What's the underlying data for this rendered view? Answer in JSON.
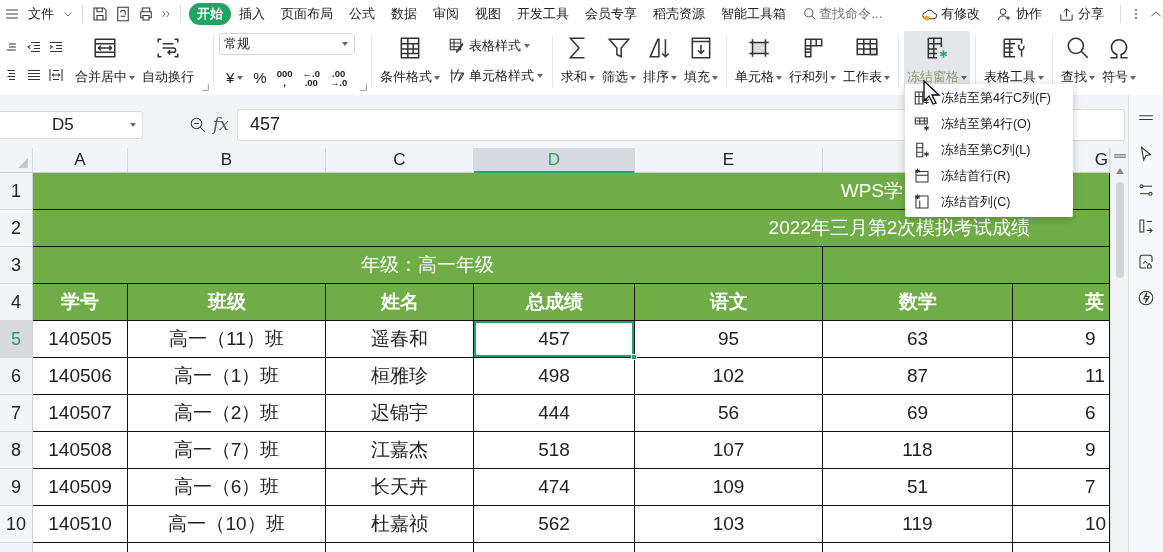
{
  "topbar": {
    "file_menu": "文件",
    "tabs": [
      {
        "label": "开始",
        "selected": true
      },
      {
        "label": "插入",
        "selected": false
      },
      {
        "label": "页面布局",
        "selected": false
      },
      {
        "label": "公式",
        "selected": false
      },
      {
        "label": "数据",
        "selected": false
      },
      {
        "label": "审阅",
        "selected": false
      },
      {
        "label": "视图",
        "selected": false
      },
      {
        "label": "开发工具",
        "selected": false
      },
      {
        "label": "会员专享",
        "selected": false
      },
      {
        "label": "稻壳资源",
        "selected": false
      },
      {
        "label": "智能工具箱",
        "selected": false
      }
    ],
    "search": {
      "placeholder": "查找命令..."
    },
    "actions": [
      "有修改",
      "协作",
      "分享"
    ]
  },
  "ribbon": [
    {
      "kind": "align",
      "tools": [
        {
          "kind": "large",
          "label": "合并居中",
          "dropdown": true,
          "active": false
        },
        {
          "kind": "large",
          "label": "自动换行",
          "dropdown": false,
          "active": false
        }
      ]
    },
    {
      "kind": "number",
      "format": {
        "value": "常规"
      },
      "buttons": [
        {
          "kind": "text",
          "label": "¥",
          "dropdown": true
        },
        {
          "kind": "text",
          "label": "%",
          "dropdown": false
        },
        {
          "kind": "stack",
          "lines": [
            "000",
            ","
          ]
        },
        {
          "kind": "stack",
          "lines": [
            "←.0",
            ".00"
          ]
        },
        {
          "kind": "stack",
          "lines": [
            ".00",
            "→.0"
          ]
        }
      ]
    },
    {
      "kind": "tools",
      "tools": [
        {
          "kind": "large",
          "label": "条件格式",
          "dropdown": true,
          "active": false
        },
        {
          "kind": "small",
          "label": "表格样式",
          "dropdown": true,
          "active": false
        },
        {
          "kind": "small",
          "label": "单元格样式",
          "dropdown": true,
          "active": false
        }
      ]
    },
    {
      "kind": "tools",
      "tools": [
        {
          "kind": "large",
          "label": "求和",
          "dropdown": true,
          "active": false
        },
        {
          "kind": "large",
          "label": "筛选",
          "dropdown": true,
          "active": false
        },
        {
          "kind": "large",
          "label": "排序",
          "dropdown": true,
          "active": false
        },
        {
          "kind": "large",
          "label": "填充",
          "dropdown": true,
          "active": false
        }
      ]
    },
    {
      "kind": "tools",
      "tools": [
        {
          "kind": "large",
          "label": "单元格",
          "dropdown": true,
          "active": false
        },
        {
          "kind": "large",
          "label": "行和列",
          "dropdown": true,
          "active": false
        },
        {
          "kind": "large",
          "label": "工作表",
          "dropdown": true,
          "active": false
        }
      ]
    },
    {
      "kind": "tools",
      "tools": [
        {
          "kind": "large",
          "label": "冻结窗格",
          "dropdown": true,
          "active": true
        }
      ]
    },
    {
      "kind": "tools",
      "tools": [
        {
          "kind": "large",
          "label": "表格工具",
          "dropdown": true,
          "active": false
        }
      ]
    },
    {
      "kind": "tools",
      "tools": [
        {
          "kind": "large",
          "label": "查找",
          "dropdown": true,
          "active": false
        },
        {
          "kind": "large",
          "label": "符号",
          "dropdown": true,
          "active": false
        }
      ]
    }
  ],
  "formula_bar": {
    "name_box": "D5",
    "fx": "fx",
    "formula": "457"
  },
  "sheet": {
    "columns": [
      {
        "label": "A",
        "selected": false
      },
      {
        "label": "B",
        "selected": false
      },
      {
        "label": "C",
        "selected": false
      },
      {
        "label": "D",
        "selected": true
      },
      {
        "label": "E",
        "selected": false
      },
      {
        "selected": false
      },
      {
        "label": "G",
        "selected": false
      }
    ],
    "rows": [
      {
        "number": "1",
        "selected": false,
        "kind": "banner_partial",
        "text": "WPS学"
      },
      {
        "number": "2",
        "selected": false,
        "kind": "banner",
        "text": "2022年三月第2次模拟考试成绩"
      },
      {
        "number": "3",
        "selected": false,
        "kind": "group",
        "label": "年级：高一年级"
      },
      {
        "number": "4",
        "selected": false,
        "kind": "header",
        "cells": [
          "学号",
          "班级",
          "姓名",
          "总成绩",
          "语文",
          "数学",
          "英"
        ]
      },
      {
        "number": "5",
        "selected": true,
        "kind": "data",
        "cells": [
          {
            "text": "140505",
            "selected": false
          },
          {
            "text": "高一（11）班",
            "selected": false
          },
          {
            "text": "遥春和",
            "selected": false
          },
          {
            "text": "457",
            "selected": true
          },
          {
            "text": "95",
            "selected": false
          },
          {
            "text": "63",
            "selected": false
          },
          {
            "text": "9",
            "selected": false
          }
        ]
      },
      {
        "number": "6",
        "selected": false,
        "kind": "data",
        "cells": [
          {
            "text": "140506",
            "selected": false
          },
          {
            "text": "高一（1）班",
            "selected": false
          },
          {
            "text": "桓雅珍",
            "selected": false
          },
          {
            "text": "498",
            "selected": false
          },
          {
            "text": "102",
            "selected": false
          },
          {
            "text": "87",
            "selected": false
          },
          {
            "text": "11",
            "selected": false
          }
        ]
      },
      {
        "number": "7",
        "selected": false,
        "kind": "data",
        "cells": [
          {
            "text": "140507",
            "selected": false
          },
          {
            "text": "高一（2）班",
            "selected": false
          },
          {
            "text": "迟锦宇",
            "selected": false
          },
          {
            "text": "444",
            "selected": false
          },
          {
            "text": "56",
            "selected": false
          },
          {
            "text": "69",
            "selected": false
          },
          {
            "text": "6",
            "selected": false
          }
        ]
      },
      {
        "number": "8",
        "selected": false,
        "kind": "data",
        "cells": [
          {
            "text": "140508",
            "selected": false
          },
          {
            "text": "高一（7）班",
            "selected": false
          },
          {
            "text": "江嘉杰",
            "selected": false
          },
          {
            "text": "518",
            "selected": false
          },
          {
            "text": "107",
            "selected": false
          },
          {
            "text": "118",
            "selected": false
          },
          {
            "text": "9",
            "selected": false
          }
        ]
      },
      {
        "number": "9",
        "selected": false,
        "kind": "data",
        "cells": [
          {
            "text": "140509",
            "selected": false
          },
          {
            "text": "高一（6）班",
            "selected": false
          },
          {
            "text": "长天卉",
            "selected": false
          },
          {
            "text": "474",
            "selected": false
          },
          {
            "text": "109",
            "selected": false
          },
          {
            "text": "51",
            "selected": false
          },
          {
            "text": "7",
            "selected": false
          }
        ]
      },
      {
        "number": "10",
        "selected": false,
        "kind": "data",
        "cells": [
          {
            "text": "140510",
            "selected": false
          },
          {
            "text": "高一（10）班",
            "selected": false
          },
          {
            "text": "杜嘉祯",
            "selected": false
          },
          {
            "text": "562",
            "selected": false
          },
          {
            "text": "103",
            "selected": false
          },
          {
            "text": "119",
            "selected": false
          },
          {
            "text": "10",
            "selected": false
          }
        ]
      }
    ]
  },
  "freeze_menu": {
    "items": [
      "冻结至第4行C列(F)",
      "冻结至第4行(O)",
      "冻结至第C列(L)",
      "冻结首行(R)",
      "冻结首列(C)"
    ]
  }
}
